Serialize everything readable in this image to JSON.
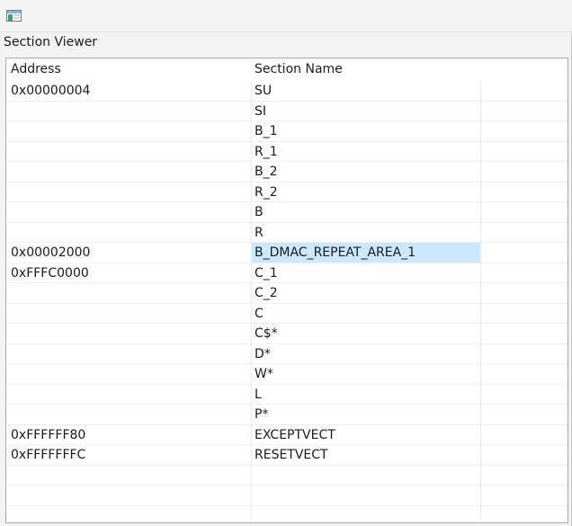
{
  "panel": {
    "title": "Section Viewer"
  },
  "toolbar": {
    "icon": "section-viewer-icon"
  },
  "table": {
    "columns": [
      "Address",
      "Section Name"
    ],
    "rows": [
      {
        "address": "0x00000004",
        "name": "SU"
      },
      {
        "address": "",
        "name": "SI"
      },
      {
        "address": "",
        "name": "B_1"
      },
      {
        "address": "",
        "name": "R_1"
      },
      {
        "address": "",
        "name": "B_2"
      },
      {
        "address": "",
        "name": "R_2"
      },
      {
        "address": "",
        "name": "B"
      },
      {
        "address": "",
        "name": "R"
      },
      {
        "address": "0x00002000",
        "name": "B_DMAC_REPEAT_AREA_1",
        "selected": true
      },
      {
        "address": "0xFFFC0000",
        "name": "C_1"
      },
      {
        "address": "",
        "name": "C_2"
      },
      {
        "address": "",
        "name": "C"
      },
      {
        "address": "",
        "name": "C$*"
      },
      {
        "address": "",
        "name": "D*"
      },
      {
        "address": "",
        "name": "W*"
      },
      {
        "address": "",
        "name": "L"
      },
      {
        "address": "",
        "name": "P*"
      },
      {
        "address": "0xFFFFFF80",
        "name": "EXCEPTVECT"
      },
      {
        "address": "0xFFFFFFFC",
        "name": "RESETVECT"
      },
      {
        "address": "",
        "name": ""
      },
      {
        "address": "",
        "name": ""
      },
      {
        "address": "",
        "name": ""
      }
    ]
  },
  "colors": {
    "selection": "#cce8ff",
    "gridline": "#ececec"
  }
}
